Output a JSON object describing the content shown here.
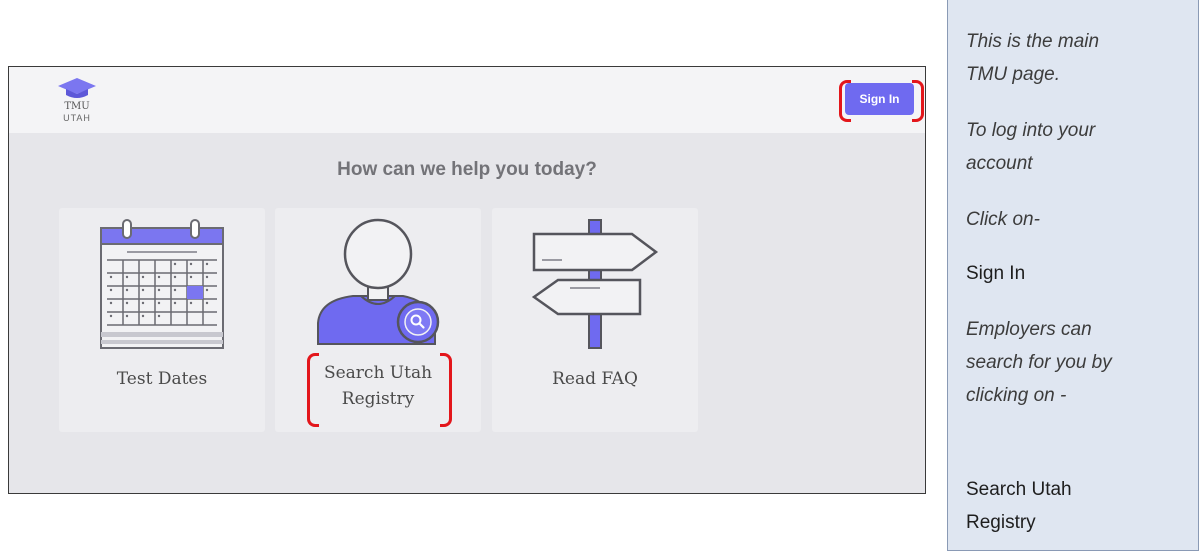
{
  "app": {
    "logo": {
      "line1": "TMU",
      "line2": "UTAH"
    },
    "signin_label": "Sign In",
    "prompt": "How can we help you today?",
    "cards": [
      {
        "label": "Test Dates"
      },
      {
        "label_line1": "Search Utah",
        "label_line2": "Registry"
      },
      {
        "label": "Read FAQ"
      }
    ],
    "colors": {
      "accent": "#6f6af0",
      "highlight": "#e3161b"
    }
  },
  "note": {
    "line1": "This is the main",
    "line2": "TMU page.",
    "line3": "To log into your",
    "line4": "account",
    "line5": "Click on-",
    "line6": "Sign In",
    "line7": "Employers can",
    "line8": "search for you by",
    "line9": "clicking on -",
    "line10": "Search Utah",
    "line11": "Registry"
  }
}
